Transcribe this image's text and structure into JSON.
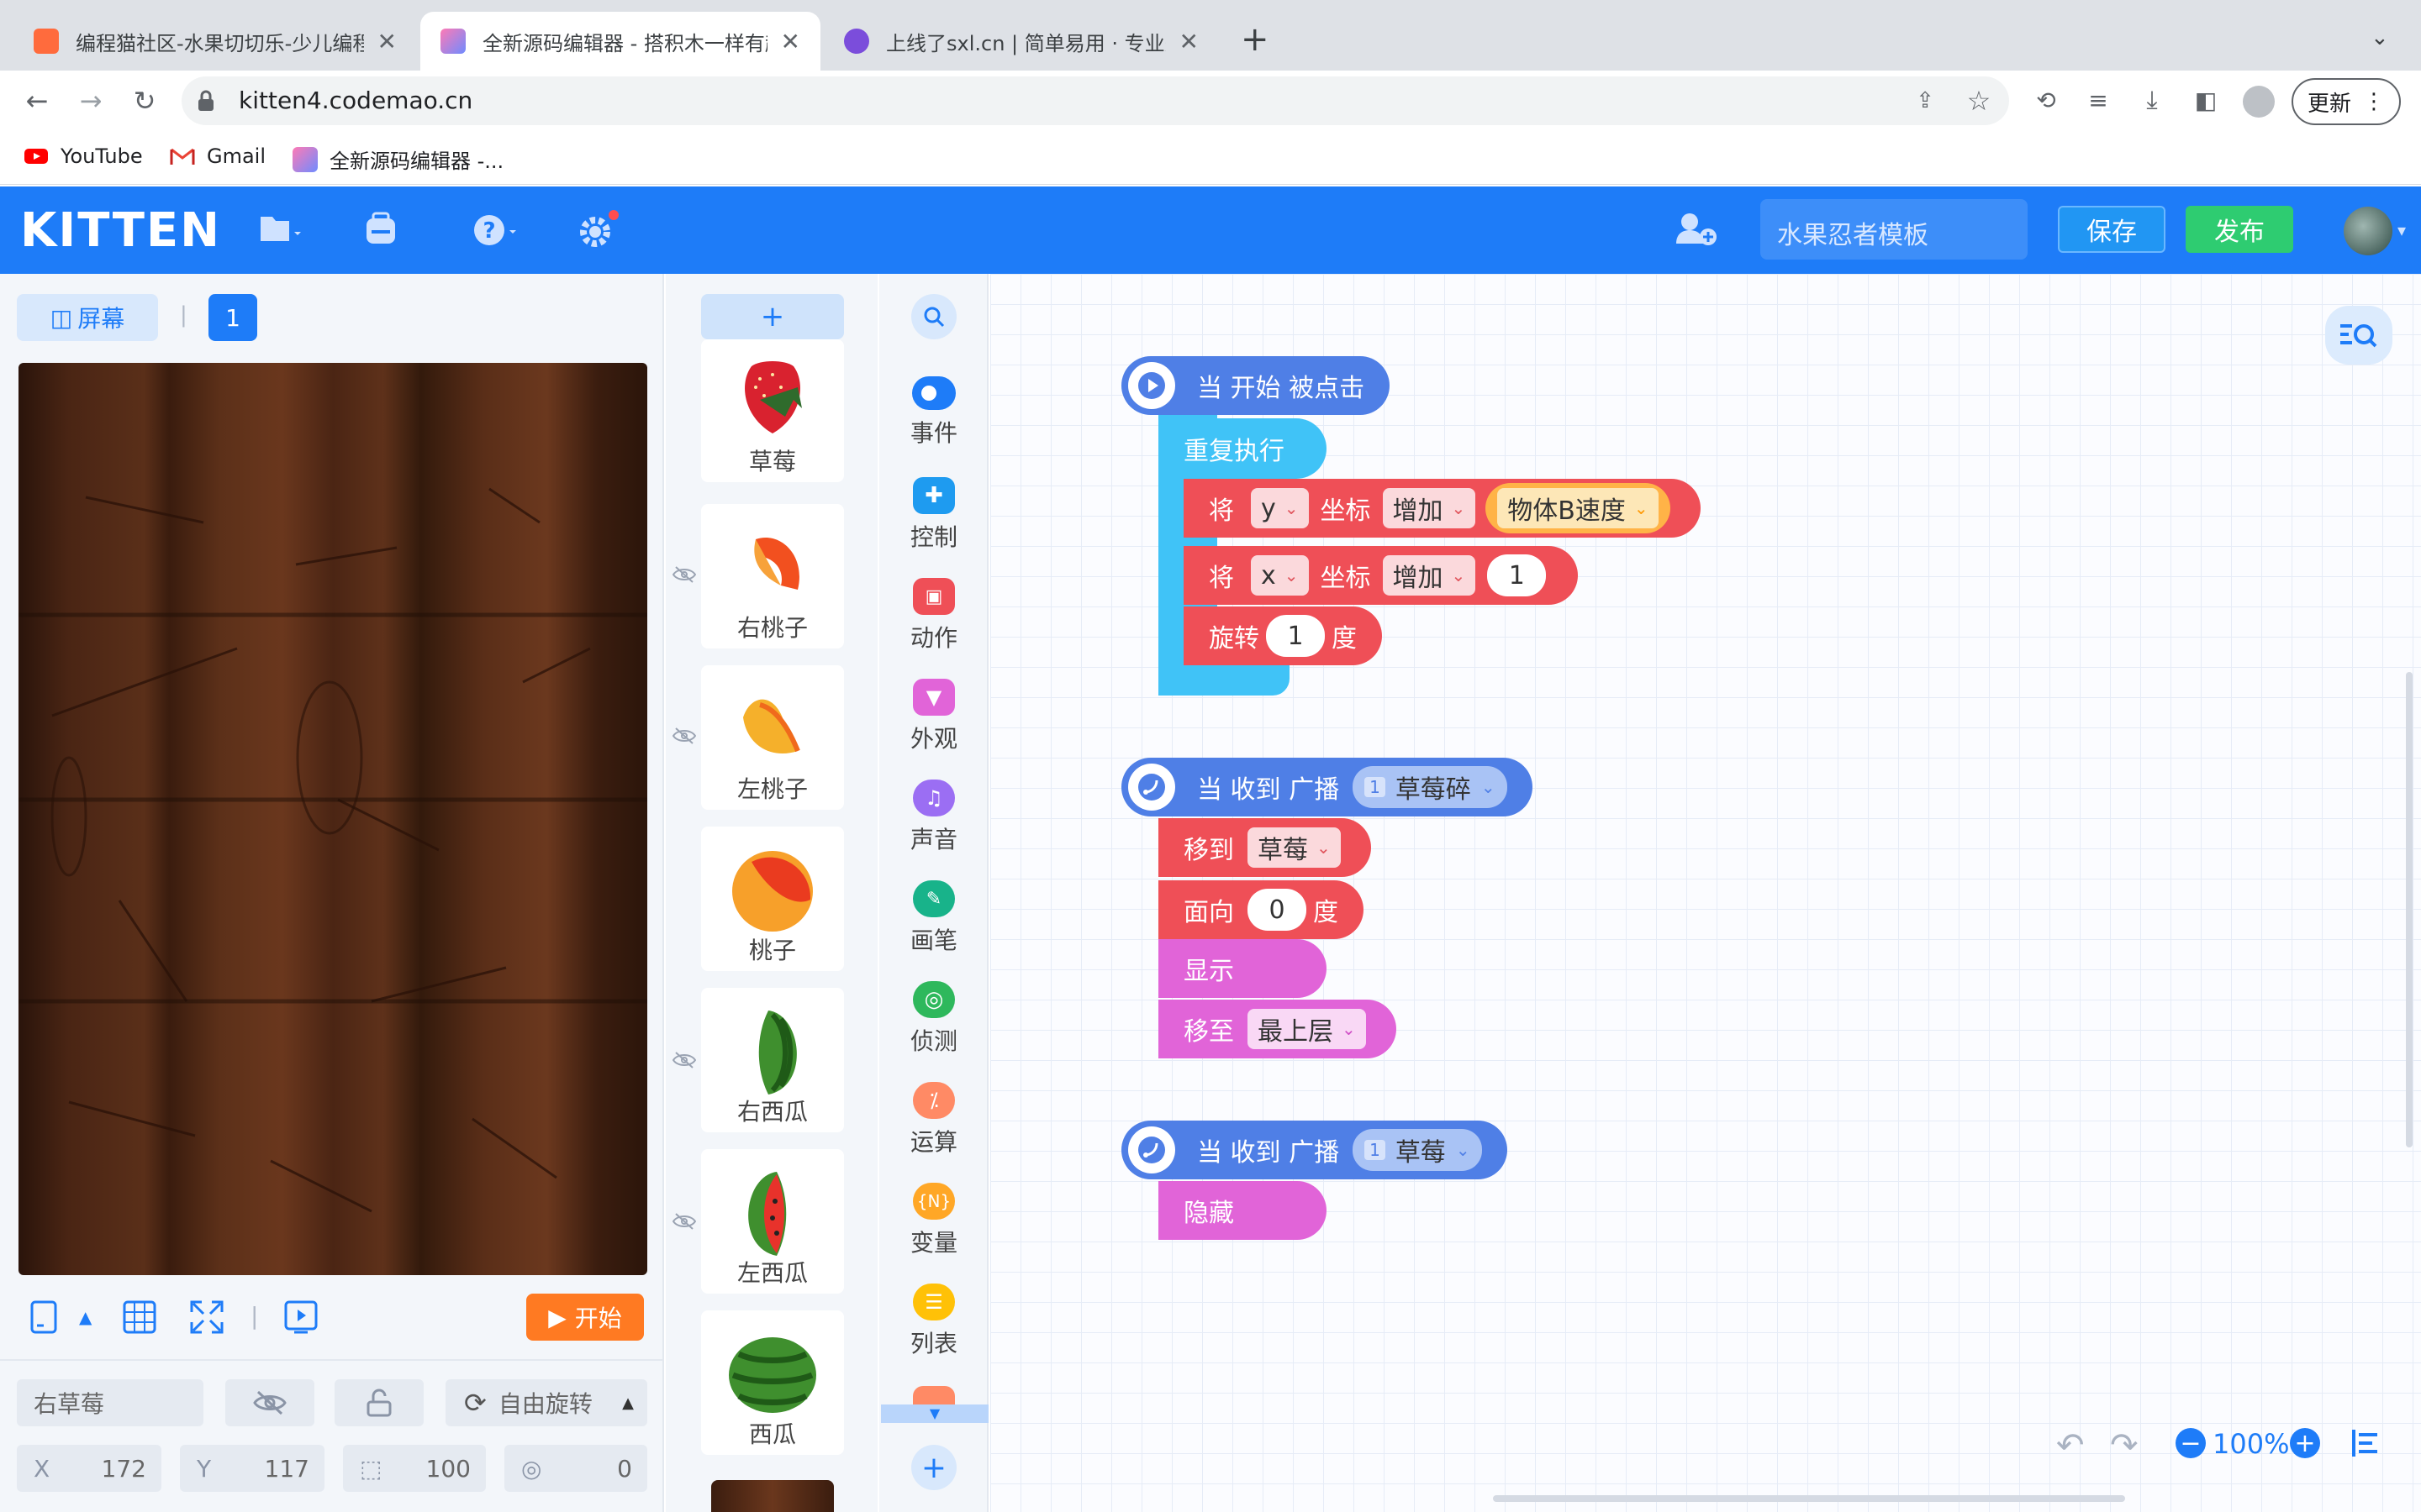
{
  "browser": {
    "tabs": [
      {
        "title": "编程猫社区-水果切切乐-少儿编程",
        "active": false
      },
      {
        "title": "全新源码编辑器 - 搭积木一样有趣",
        "active": true
      },
      {
        "title": "上线了sxl.cn | 简单易用 · 专业美",
        "active": false
      }
    ],
    "new_tab_glyph": "+",
    "url": "kitten4.codemao.cn",
    "update_label": "更新",
    "bookmarks": [
      {
        "label": "YouTube",
        "icon": "youtube-icon"
      },
      {
        "label": "Gmail",
        "icon": "gmail-icon"
      },
      {
        "label": "全新源码编辑器 -...",
        "icon": "kitten-icon"
      }
    ]
  },
  "header": {
    "logo": "KITTEN",
    "project_name": "水果忍者模板",
    "save_label": "保存",
    "publish_label": "发布",
    "colors": {
      "bar": "#1e7cf8",
      "save": "#2196f3",
      "publish": "#2ecc71"
    }
  },
  "stage_panel": {
    "screen_label": "屏幕",
    "scene_number": "1",
    "start_label": "开始",
    "sprite_name": "右草莓",
    "rotation_mode": "自由旋转",
    "x_label": "X",
    "x": "172",
    "y_label": "Y",
    "y": "117",
    "scale": "100",
    "angle": "0"
  },
  "sprites": {
    "add_label": "+",
    "items": [
      {
        "name": "草莓",
        "hidden": false
      },
      {
        "name": "右桃子",
        "hidden": true
      },
      {
        "name": "左桃子",
        "hidden": true
      },
      {
        "name": "桃子",
        "hidden": false
      },
      {
        "name": "右西瓜",
        "hidden": true
      },
      {
        "name": "左西瓜",
        "hidden": true
      },
      {
        "name": "西瓜",
        "hidden": false
      }
    ]
  },
  "categories": [
    {
      "label": "事件",
      "color": "#1e7cf8"
    },
    {
      "label": "控制",
      "color": "#1e9bf0"
    },
    {
      "label": "动作",
      "color": "#ef4f57"
    },
    {
      "label": "外观",
      "color": "#e164d8"
    },
    {
      "label": "声音",
      "color": "#9b6ef3"
    },
    {
      "label": "画笔",
      "color": "#18b38a"
    },
    {
      "label": "侦测",
      "color": "#2eb85c"
    },
    {
      "label": "运算",
      "color": "#ff8a65"
    },
    {
      "label": "变量",
      "color": "#ffa726"
    },
    {
      "label": "列表",
      "color": "#ffc107"
    }
  ],
  "scripts": {
    "script1": {
      "hat": "当 开始 被点击",
      "repeat": "重复执行",
      "move_y": {
        "verb": "将",
        "axis": "y",
        "coord": "坐标",
        "op": "增加",
        "value": "物体B速度"
      },
      "move_x": {
        "verb": "将",
        "axis": "x",
        "coord": "坐标",
        "op": "增加",
        "value": "1"
      },
      "rotate": {
        "verb": "旋转",
        "value": "1",
        "unit": "度"
      }
    },
    "script2": {
      "hat": "当 收到 广播",
      "broadcast_tag": "1",
      "broadcast": "草莓碎",
      "move_to": {
        "verb": "移到",
        "target": "草莓"
      },
      "face": {
        "verb": "面向",
        "value": "0",
        "unit": "度"
      },
      "show": "显示",
      "layer": {
        "verb": "移至",
        "target": "最上层"
      }
    },
    "script3": {
      "hat": "当 收到 广播",
      "broadcast_tag": "1",
      "broadcast": "草莓",
      "hide": "隐藏"
    }
  },
  "workspace": {
    "zoom": "100%"
  }
}
